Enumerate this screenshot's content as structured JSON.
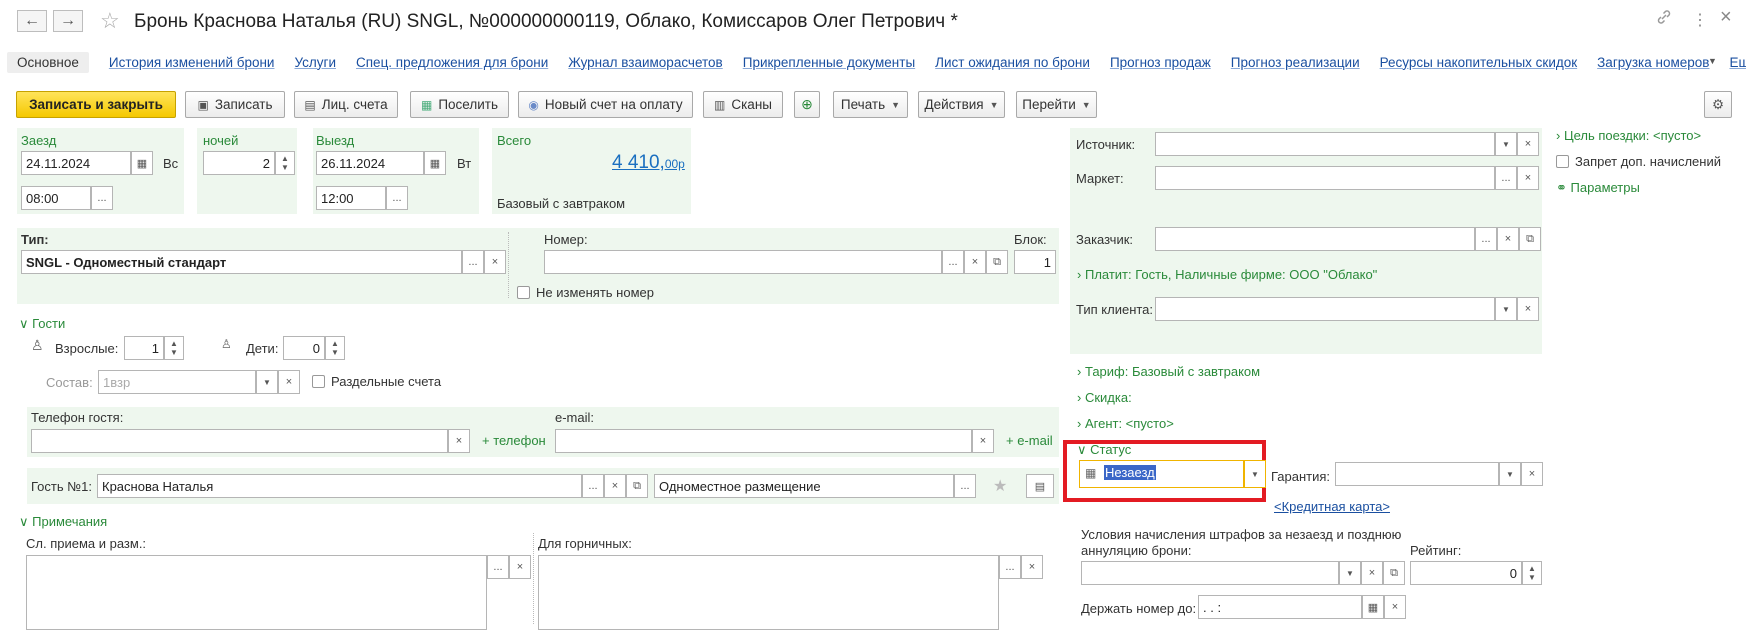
{
  "window": {
    "title": "Бронь Краснова Наталья (RU) SNGL, №000000000119, Облако, Комиссаров Олег Петрович *",
    "back_glyph": "←",
    "forward_glyph": "→",
    "star_glyph": "☆",
    "link_glyph": "🔗",
    "more_glyph": "⋮",
    "close_glyph": "×"
  },
  "tabs": [
    {
      "label": "Основное"
    },
    {
      "label": "История изменений брони"
    },
    {
      "label": "Услуги"
    },
    {
      "label": "Спец. предложения для брони"
    },
    {
      "label": "Журнал взаиморасчетов"
    },
    {
      "label": "Прикрепленные документы"
    },
    {
      "label": "Лист ожидания по брони"
    },
    {
      "label": "Прогноз продаж"
    },
    {
      "label": "Прогноз реализации"
    },
    {
      "label": "Ресурсы накопительных скидок"
    },
    {
      "label": "Загрузка номеров"
    },
    {
      "label": "Еще..."
    }
  ],
  "toolbar": {
    "save_close": "Записать и закрыть",
    "save": "Записать",
    "accounts": "Лиц. счета",
    "settle": "Поселить",
    "new_invoice": "Новый счет на оплату",
    "scans": "Сканы",
    "print": "Печать",
    "actions": "Действия",
    "goto": "Перейти"
  },
  "stay": {
    "checkin_label": "Заезд",
    "checkin_date": "24.11.2024",
    "checkin_dow": "Вс",
    "checkin_time": "08:00",
    "nights_label": "ночей",
    "nights": "2",
    "checkout_label": "Выезд",
    "checkout_date": "26.11.2024",
    "checkout_dow": "Вт",
    "checkout_time": "12:00",
    "total_label": "Всего",
    "total_main": "4 410,",
    "total_cents": "00р",
    "rate_name": "Базовый с завтраком"
  },
  "room": {
    "type_label": "Тип:",
    "type_value": "SNGL - Одноместный стандарт",
    "number_label": "Номер:",
    "number_value": "",
    "block_label": "Блок:",
    "block_value": "1",
    "keep_number_label": "Не изменять номер"
  },
  "guests": {
    "section_label": "Гости",
    "adults_label": "Взрослые:",
    "adults": "1",
    "children_label": "Дети:",
    "children": "0",
    "composition_label": "Состав:",
    "composition": "1взр",
    "separate_accounts_label": "Раздельные счета",
    "phone_label": "Телефон гостя:",
    "phone_value": "",
    "add_phone": "+ телефон",
    "email_label": "e-mail:",
    "email_value": "",
    "add_email": "+ e-mail",
    "guest1_label": "Гость №1:",
    "guest1_name": "Краснова Наталья",
    "guest1_accommodation": "Одноместное размещение"
  },
  "notes": {
    "section_label": "Примечания",
    "reception_label": "Сл. приема и разм.:",
    "housekeeping_label": "Для горничных:"
  },
  "right": {
    "source_label": "Источник:",
    "market_label": "Маркет:",
    "customer_label": "Заказчик:",
    "payer": "Платит: Гость, Наличные фирме: ООО \"Облако\"",
    "client_type_label": "Тип клиента:",
    "tariff": "Тариф: Базовый с завтраком",
    "discount": "Скидка:",
    "agent": "Агент: <пусто>",
    "status_section": "Статус",
    "status_value": "Незаезд",
    "guarantee_label": "Гарантия:",
    "credit_card": "<Кредитная карта>",
    "penalty_label_1": "Условия начисления штрафов за незаезд и позднюю",
    "penalty_label_2": "аннуляцию брони:",
    "rating_label": "Рейтинг:",
    "rating": "0",
    "hold_until_label": "Держать номер до:",
    "hold_until": ". .      :"
  },
  "side": {
    "trip_goal": "Цель поездки: <пусто>",
    "no_extra_charges": "Запрет доп. начислений",
    "parameters": "Параметры"
  },
  "colors": {
    "accent_green": "#2a8a3a",
    "link_blue": "#1a4fa0",
    "panel_bg": "#eef7ee",
    "primary_yellow": "#f5c800",
    "highlight_red": "#e31b23",
    "focus_orange": "#f0b400"
  }
}
